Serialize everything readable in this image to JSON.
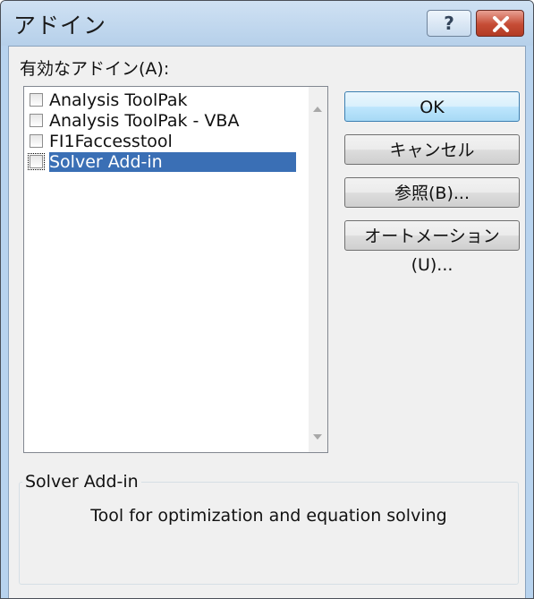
{
  "window": {
    "title": "アドイン",
    "help_label": "?"
  },
  "addins": {
    "label": "有効なアドイン(A):",
    "items": [
      {
        "label": "Analysis ToolPak",
        "checked": false,
        "selected": false
      },
      {
        "label": "Analysis ToolPak - VBA",
        "checked": false,
        "selected": false
      },
      {
        "label": "FI1Faccesstool",
        "checked": false,
        "selected": false
      },
      {
        "label": "Solver Add-in",
        "checked": false,
        "selected": true
      }
    ]
  },
  "buttons": {
    "ok": "OK",
    "cancel": "キャンセル",
    "browse": "参照(B)...",
    "automation": "オートメーション(U)..."
  },
  "description": {
    "title": "Solver Add-in",
    "text": "Tool for optimization and equation solving"
  },
  "colors": {
    "title_bar": "#b8d3ee",
    "selection": "#3a6fb5",
    "close_button": "#c64c35",
    "dialog_background": "#f0f0f0"
  },
  "icons": {
    "close": "close-icon",
    "help": "help-icon",
    "scroll_up": "scroll-up-arrow-icon",
    "scroll_down": "scroll-down-arrow-icon"
  }
}
